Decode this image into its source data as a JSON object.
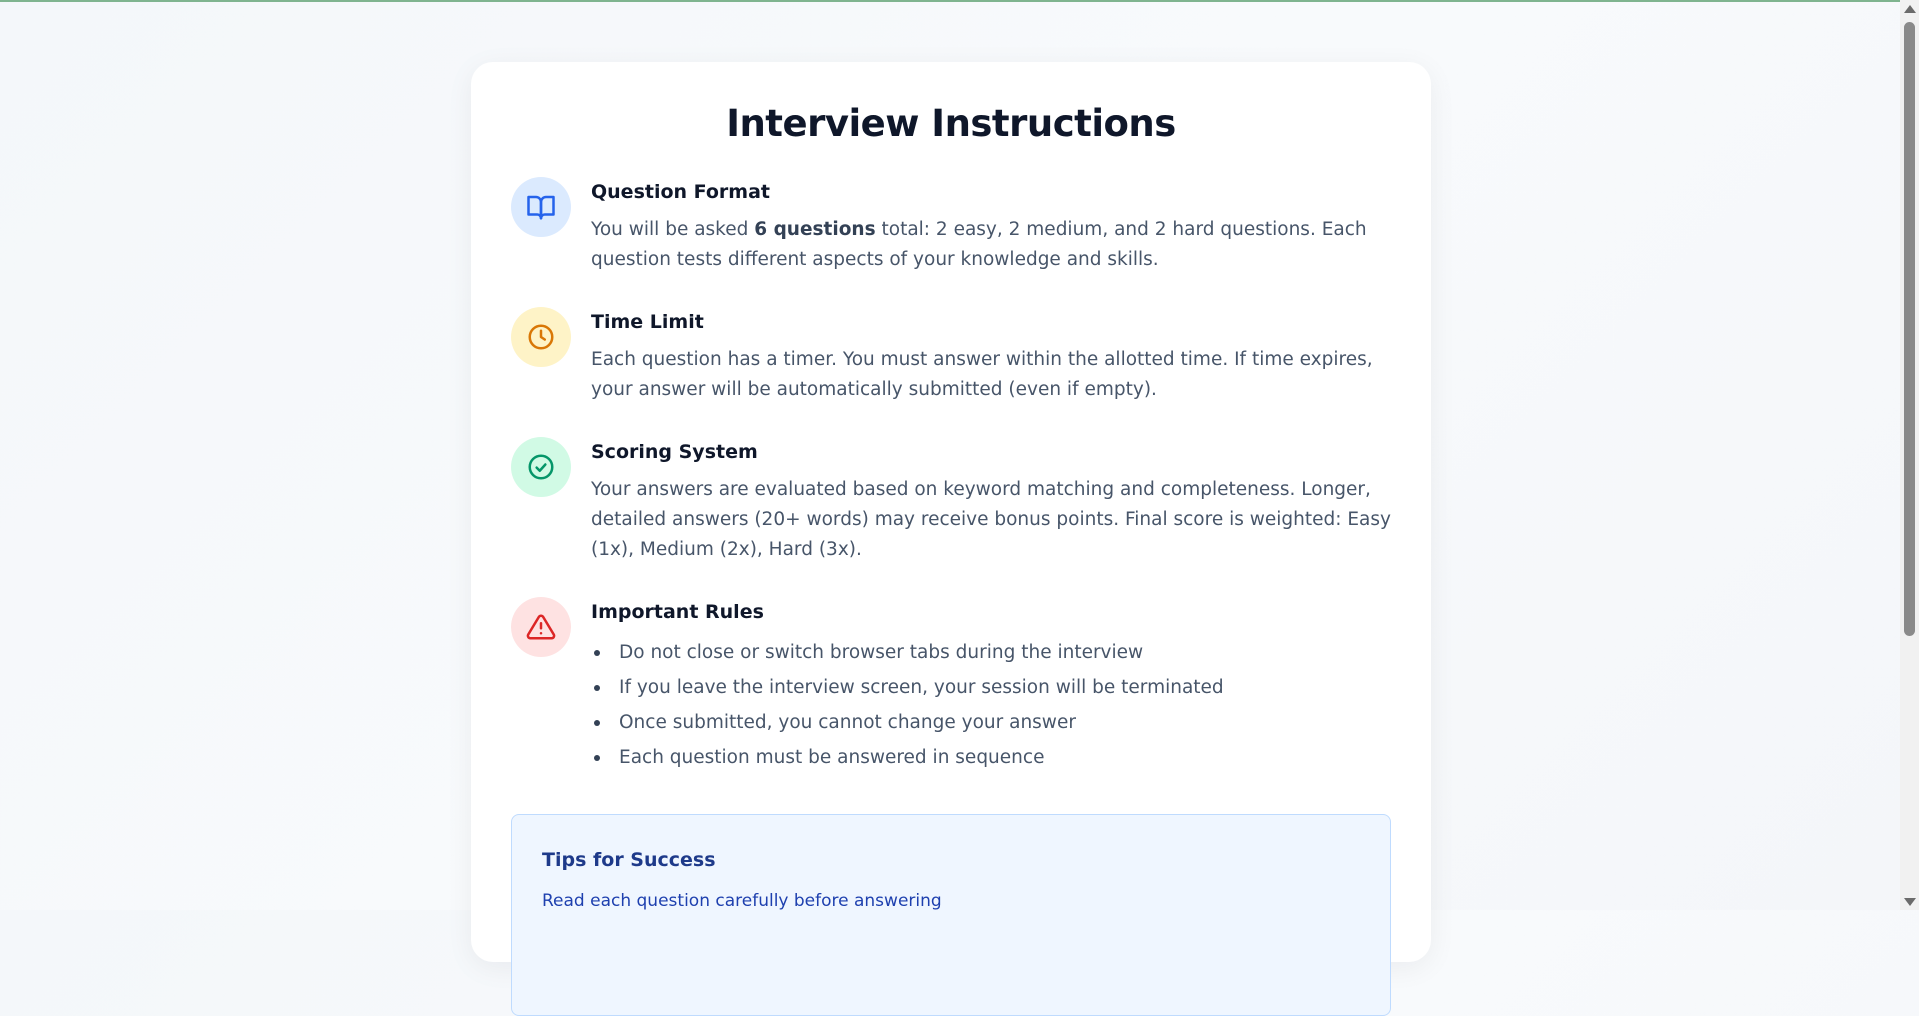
{
  "title": "Interview Instructions",
  "colors": {
    "accent_bar": "#7fb48f",
    "blue": "#2563eb",
    "amber": "#d97706",
    "green": "#059669",
    "red": "#dc2626",
    "tips_bg": "#eff6ff"
  },
  "sections": [
    {
      "icon": "book-open-icon",
      "title": "Question Format",
      "text_before": "You will be asked ",
      "text_bold": "6 questions",
      "text_after": " total: 2 easy, 2 medium, and 2 hard questions. Each question tests different aspects of your knowledge and skills."
    },
    {
      "icon": "clock-icon",
      "title": "Time Limit",
      "text": "Each question has a timer. You must answer within the allotted time. If time expires, your answer will be automatically submitted (even if empty)."
    },
    {
      "icon": "check-circle-icon",
      "title": "Scoring System",
      "text": "Your answers are evaluated based on keyword matching and completeness. Longer, detailed answers (20+ words) may receive bonus points. Final score is weighted: Easy (1x), Medium (2x), Hard (3x)."
    },
    {
      "icon": "warning-triangle-icon",
      "title": "Important Rules",
      "rules": [
        "Do not close or switch browser tabs during the interview",
        "If you leave the interview screen, your session will be terminated",
        "Once submitted, you cannot change your answer",
        "Each question must be answered in sequence"
      ]
    }
  ],
  "tips": {
    "title": "Tips for Success",
    "first_tip": "Read each question carefully before answering"
  }
}
